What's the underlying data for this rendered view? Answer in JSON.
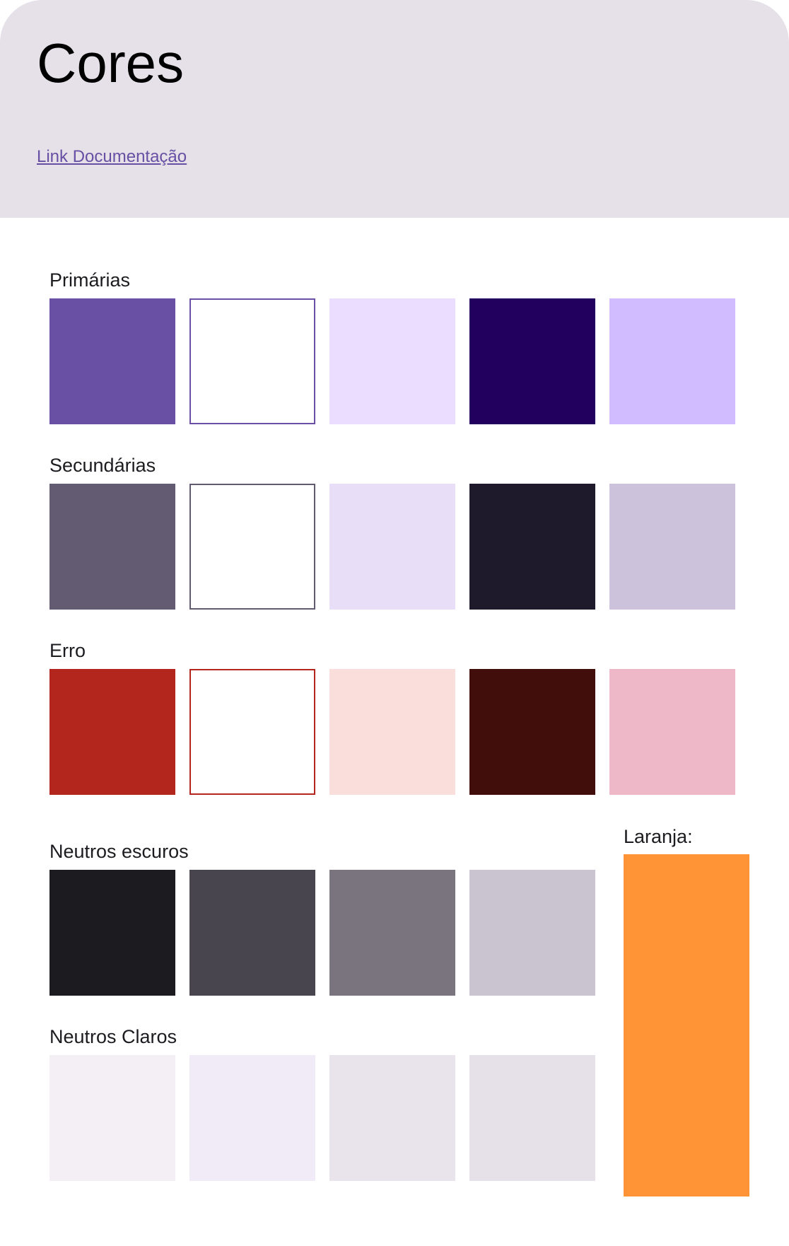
{
  "header": {
    "title": "Cores",
    "link_label": "Link Documentação"
  },
  "palettes": {
    "primarias": {
      "label": "Primárias",
      "swatches": [
        {
          "color": "#6a50a4"
        },
        {
          "color": "#ffffff",
          "outline": "#6a50a4"
        },
        {
          "color": "#eaddff"
        },
        {
          "color": "#21005e"
        },
        {
          "color": "#d0bcff"
        }
      ]
    },
    "secundarias": {
      "label": "Secundárias",
      "swatches": [
        {
          "color": "#625b71"
        },
        {
          "color": "#ffffff",
          "outline": "#625b71"
        },
        {
          "color": "#e8def8"
        },
        {
          "color": "#1e192b"
        },
        {
          "color": "#ccc2dc"
        }
      ]
    },
    "erro": {
      "label": "Erro",
      "swatches": [
        {
          "color": "#b3261e"
        },
        {
          "color": "#ffffff",
          "outline": "#b3261e"
        },
        {
          "color": "#f9dedc"
        },
        {
          "color": "#410e0b"
        },
        {
          "color": "#efb8c8"
        }
      ]
    },
    "neutros_escuros": {
      "label": "Neutros escuros",
      "swatches": [
        {
          "color": "#1c1b1f"
        },
        {
          "color": "#49454f"
        },
        {
          "color": "#79747e"
        },
        {
          "color": "#cac4d0"
        }
      ]
    },
    "neutros_claros": {
      "label": "Neutros Claros",
      "swatches": [
        {
          "color": "#f4eff4"
        },
        {
          "color": "#f0ebf6"
        },
        {
          "color": "#e9e4ec"
        },
        {
          "color": "#e6e1e9"
        }
      ]
    }
  },
  "laranja": {
    "label": "Laranja:",
    "color": "#fe9436"
  }
}
